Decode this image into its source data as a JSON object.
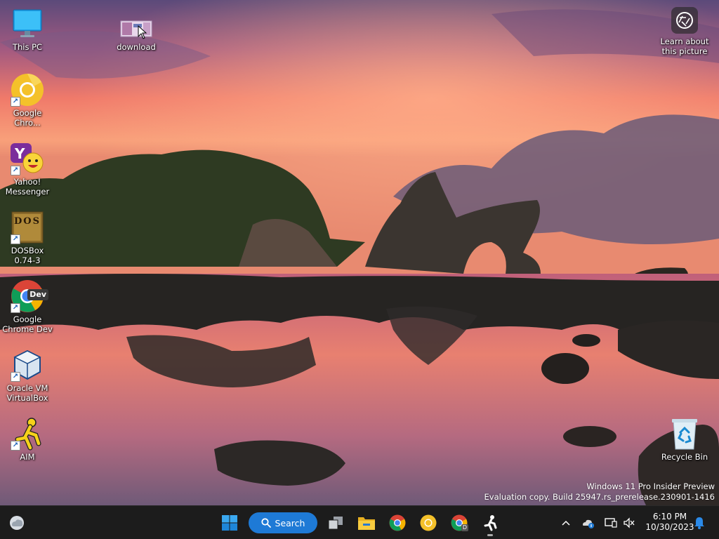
{
  "desktop": {
    "icons": [
      {
        "name": "this-pc",
        "label": "This PC"
      },
      {
        "name": "download",
        "label": "download"
      },
      {
        "name": "google-chrome",
        "label": "Google Chro..."
      },
      {
        "name": "yahoo-messenger",
        "label": "Yahoo! Messenger"
      },
      {
        "name": "dosbox",
        "label": "DOSBox 0.74-3"
      },
      {
        "name": "google-chrome-dev",
        "label": "Google Chrome Dev"
      },
      {
        "name": "oracle-vm-virtualbox",
        "label": "Oracle VM VirtualBox"
      },
      {
        "name": "aim",
        "label": "AIM"
      },
      {
        "name": "recycle-bin",
        "label": "Recycle Bin"
      }
    ],
    "learn_about_picture": "Learn about this picture",
    "dosbox_icon_letters": "DOS",
    "chrome_dev_badge": "Dev"
  },
  "watermark": {
    "line1": "Windows 11 Pro Insider Preview",
    "line2": "Evaluation copy. Build 25947.rs_prerelease.230901-1416"
  },
  "taskbar": {
    "search_label": "Search",
    "clock_time": "6:10 PM",
    "clock_date": "10/30/2023",
    "chrome_dev_letter": "D",
    "accent": "#1e7ad6",
    "background": "#1c1c1c"
  }
}
